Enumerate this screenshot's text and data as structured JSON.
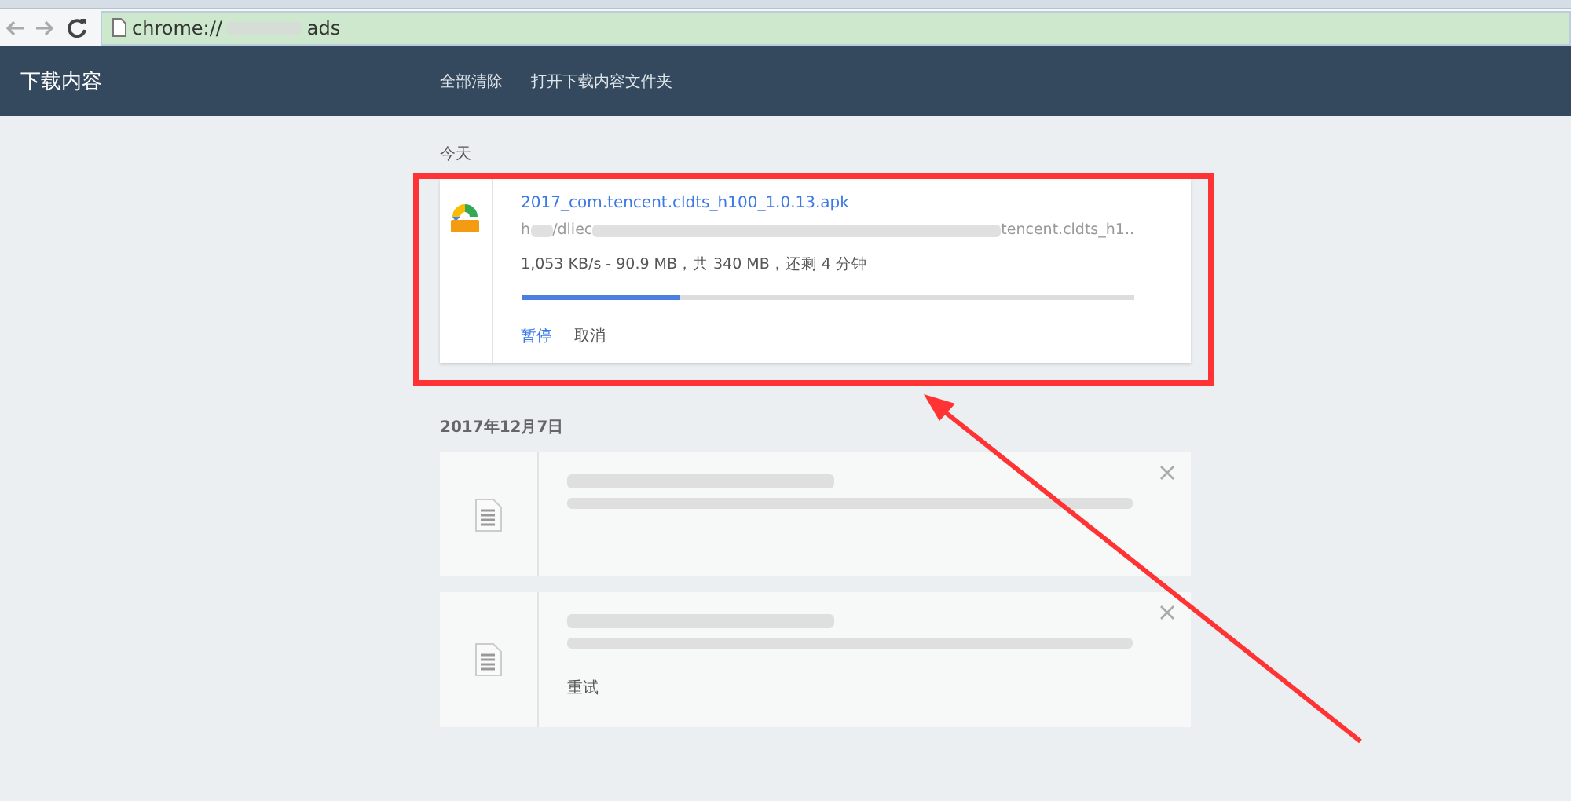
{
  "address_bar": {
    "prefix": "chrome://",
    "suffix": "ads"
  },
  "header": {
    "title": "下载内容",
    "actions": [
      "全部清除",
      "打开下载内容文件夹"
    ]
  },
  "sections": [
    {
      "date": "今天",
      "items": [
        {
          "kind": "active",
          "file_name": "2017_com.tencent.cldts_h100_1.0.13.apk",
          "url_start": "h",
          "url_mid": "/dliec",
          "url_end": "tencent.cldts_h1..",
          "status": "1,053 KB/s - 90.9 MB，共 340 MB，还剩 4 分钟",
          "level": 0.26,
          "actions": [
            {
              "label": "暂停",
              "primary": true
            },
            {
              "label": "取消",
              "primary": false
            }
          ]
        }
      ]
    },
    {
      "date": "2017年12月7日",
      "items": [
        {
          "kind": "failed"
        },
        {
          "kind": "failed",
          "actions": [
            {
              "label": "重试",
              "primary": false
            }
          ]
        }
      ]
    }
  ]
}
